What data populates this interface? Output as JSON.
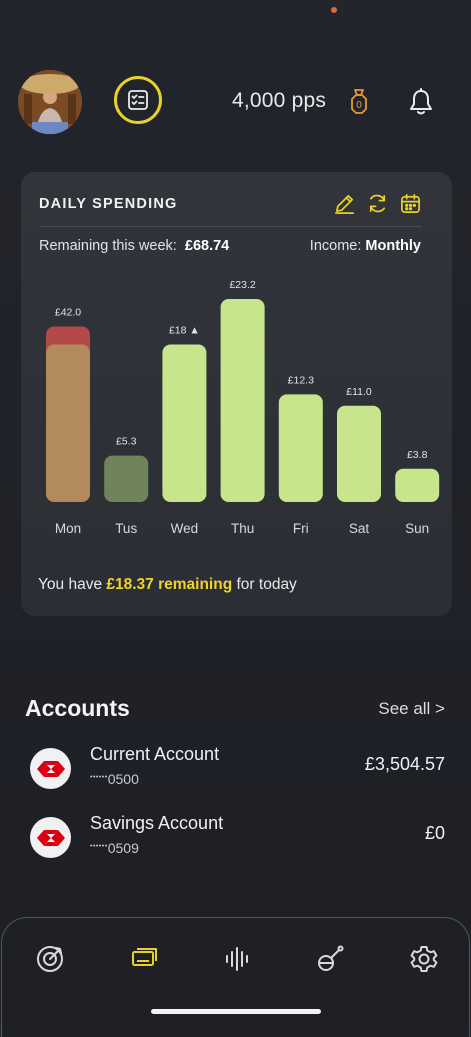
{
  "header": {
    "points": "4,000 pps",
    "badge_count": "0",
    "avatar_icon": "user-avatar",
    "tasks_icon": "checklist-icon",
    "bell_icon": "bell-icon"
  },
  "daily_spending": {
    "title": "DAILY SPENDING",
    "actions": [
      "edit-icon",
      "refresh-icon",
      "calendar-icon"
    ],
    "remaining_week_label": "Remaining this week:",
    "remaining_week_value": "£68.74",
    "income_label": "Income:",
    "income_value": "Monthly",
    "today_prefix": "You have",
    "today_amount": "£18.37 remaining",
    "today_suffix": "for today"
  },
  "chart_data": {
    "type": "bar",
    "categories": [
      "Mon",
      "Tus",
      "Wed",
      "Thu",
      "Fri",
      "Sat",
      "Sun"
    ],
    "values": [
      42.0,
      5.3,
      18,
      23.2,
      12.3,
      11.0,
      3.8
    ],
    "value_labels": [
      "£42.0",
      "£5.3",
      "£18 ▲",
      "£23.2",
      "£12.3",
      "£11.0",
      "£3.8"
    ],
    "bar_colors": [
      "#b28a5c",
      "#6f845a",
      "#c7e68c",
      "#c7e68c",
      "#c7e68c",
      "#c7e68c",
      "#c7e68c"
    ],
    "overflow_color": "#b34a48",
    "title": "",
    "xlabel": "",
    "ylabel": "",
    "grid": false
  },
  "accounts": {
    "title": "Accounts",
    "see_all": "See all >",
    "items": [
      {
        "name": "Current Account",
        "mask": "••••••",
        "number": "0500",
        "balance": "£3,504.57"
      },
      {
        "name": "Savings Account",
        "mask": "••••••",
        "number": "0509",
        "balance": "£0"
      }
    ]
  },
  "nav": {
    "items": [
      "target-icon",
      "cards-icon",
      "waveform-icon",
      "insights-icon",
      "settings-icon"
    ],
    "active_index": 1,
    "active_color": "#e7d229",
    "inactive_color": "#d9d9dd"
  },
  "colors": {
    "accent": "#e7d229",
    "bar_green": "#c7e68c",
    "background": "#1f2127",
    "card": "#2f3138"
  }
}
